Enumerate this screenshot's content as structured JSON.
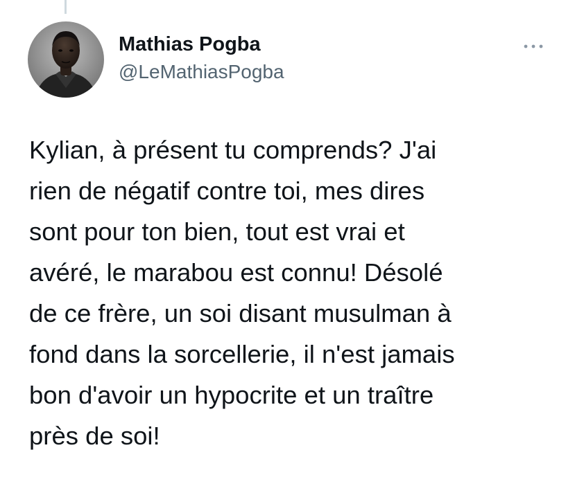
{
  "tweet": {
    "author": {
      "display_name": "Mathias Pogba",
      "handle": "@LeMathiasPogba",
      "avatar_icon": "user-avatar-photo"
    },
    "more_icon": "more-horizontal-icon",
    "text_lines": [
      "Kylian, à présent tu comprends? J'ai",
      "rien de négatif contre toi, mes dires",
      "sont pour ton bien, tout est vrai et",
      "avéré, le marabou est connu! Désolé",
      "de ce frère, un soi disant musulman à",
      "fond dans la sorcellerie, il n'est jamais",
      "bon d'avoir un hypocrite et un traître",
      "près de soi!"
    ]
  },
  "colors": {
    "text_primary": "#0f1419",
    "text_secondary": "#536471",
    "thread_line": "#cfd9de",
    "more_icon": "#8b98a5"
  }
}
